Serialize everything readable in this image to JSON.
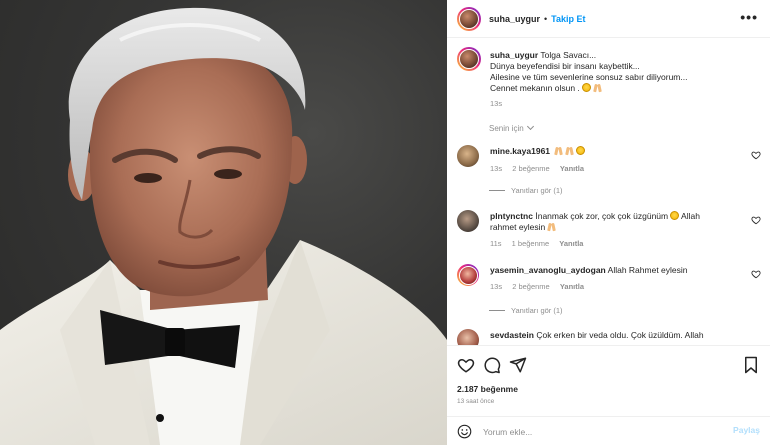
{
  "header": {
    "username": "suha_uygur",
    "separator": "•",
    "follow_label": "Takip Et",
    "more_icon": "more-icon",
    "more_label": "•••"
  },
  "caption": {
    "username": "suha_uygur",
    "lines": [
      "Tolga Savacı...",
      "Dünya beyefendisi bir insanı kaybettik...",
      "Ailesine ve tüm sevenlerine sonsuz sabır diliyorum...",
      "Cennet mekanın olsun ."
    ],
    "time": "13s"
  },
  "seen_for": "Senin için",
  "comments": [
    {
      "username": "mine.kaya1961",
      "text": "",
      "time": "13s",
      "likes": "2 beğenme",
      "reply": "Yanıtla",
      "replies": "Yanıtları gör (1)"
    },
    {
      "username": "plntynctnc",
      "text": "İnanmak çok zor, çok çok üzgünüm",
      "text2": "Allah rahmet eylesin",
      "time": "11s",
      "likes": "1 beğenme",
      "reply": "Yanıtla"
    },
    {
      "username": "yasemin_avanoglu_aydogan",
      "text": "Allah Rahmet eylesin",
      "time": "13s",
      "likes": "2 beğenme",
      "reply": "Yanıtla",
      "replies": "Yanıtları gör (1)"
    },
    {
      "username": "sevdastein",
      "text": "Çok erken bir veda oldu. Çok üzüldüm. Allah"
    }
  ],
  "actions": {
    "likes": "2.187 beğenme",
    "time_ago": "13 saat önce"
  },
  "add_comment": {
    "placeholder": "Yorum ekle...",
    "post_label": "Paylaş"
  },
  "colors": {
    "follow": "#0095f6",
    "muted": "#8e8e8e",
    "post_disabled": "#b2dffc"
  }
}
